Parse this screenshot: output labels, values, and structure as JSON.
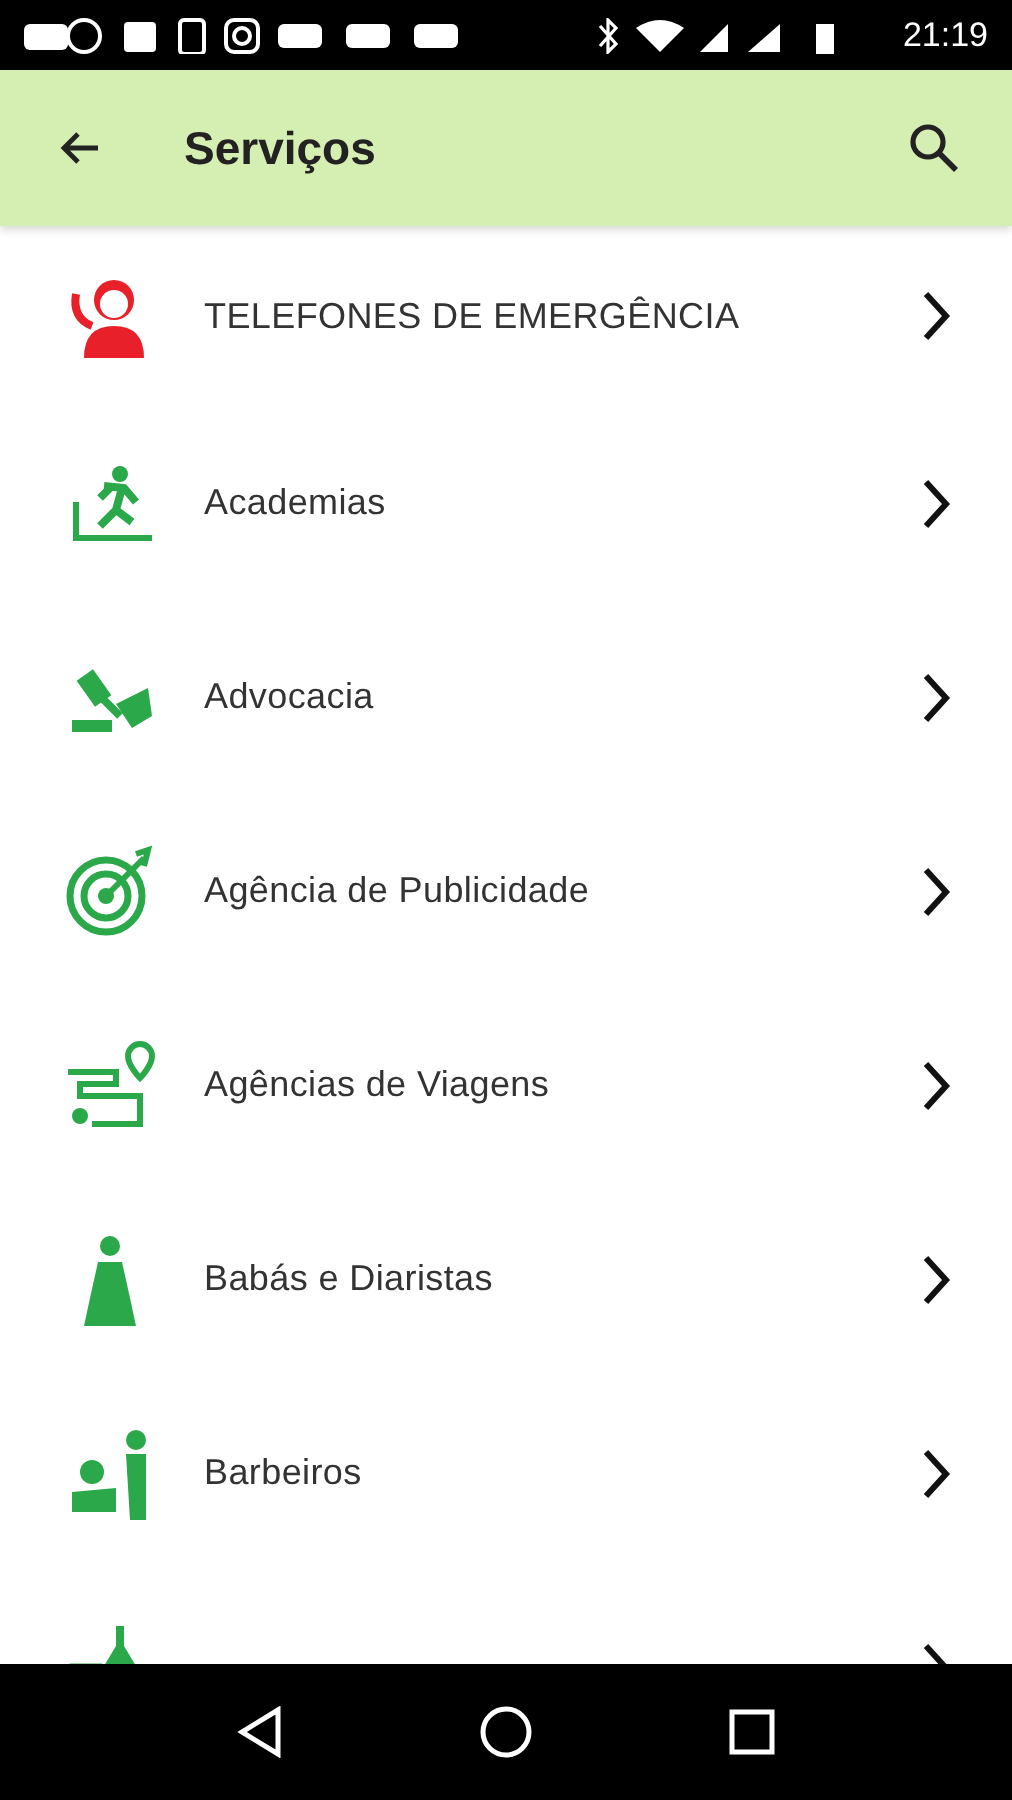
{
  "status_bar": {
    "time": "21:19"
  },
  "app_bar": {
    "title": "Serviços"
  },
  "items": [
    {
      "label": "TELEFONES DE EMERGÊNCIA",
      "color": "#e8202a"
    },
    {
      "label": "Academias",
      "color": "#2aa84a"
    },
    {
      "label": "Advocacia",
      "color": "#2aa84a"
    },
    {
      "label": "Agência de Publicidade",
      "color": "#2aa84a"
    },
    {
      "label": "Agências de Viagens",
      "color": "#2aa84a"
    },
    {
      "label": "Babás e Diaristas",
      "color": "#2aa84a"
    },
    {
      "label": "Barbeiros",
      "color": "#2aa84a"
    },
    {
      "color": "#2aa84a"
    }
  ]
}
